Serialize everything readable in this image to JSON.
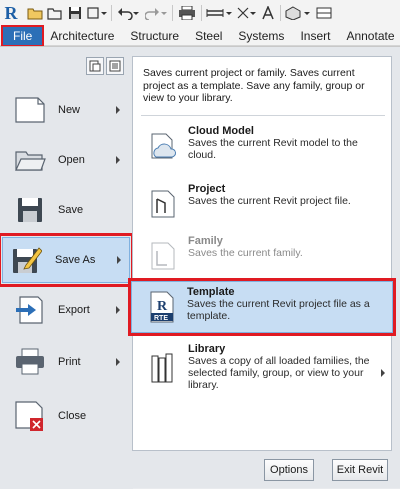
{
  "app": {
    "logo": "R"
  },
  "quick_access": {
    "icons": [
      "open-icon",
      "save-icon",
      "sync-icon",
      "undo-icon",
      "redo-icon",
      "print-icon",
      "measure-icon",
      "text-icon",
      "view-icon"
    ]
  },
  "ribbon": {
    "tabs": [
      {
        "label": "File"
      },
      {
        "label": "Architecture"
      },
      {
        "label": "Structure"
      },
      {
        "label": "Steel"
      },
      {
        "label": "Systems"
      },
      {
        "label": "Insert"
      },
      {
        "label": "Annotate"
      }
    ]
  },
  "menu": {
    "items": [
      {
        "label": "New",
        "has_submenu": true
      },
      {
        "label": "Open",
        "has_submenu": true
      },
      {
        "label": "Save",
        "has_submenu": false
      },
      {
        "label": "Save As",
        "has_submenu": true
      },
      {
        "label": "Export",
        "has_submenu": true
      },
      {
        "label": "Print",
        "has_submenu": true
      },
      {
        "label": "Close",
        "has_submenu": false
      }
    ],
    "description": "Saves current project or family. Saves current project as a template. Save any family, group or view to your library.",
    "options": [
      {
        "title": "Cloud Model",
        "text": "Saves the current Revit model to the cloud."
      },
      {
        "title": "Project",
        "text": "Saves the current Revit project file."
      },
      {
        "title": "Family",
        "text": "Saves the current family."
      },
      {
        "title": "Template",
        "text": "Saves the current Revit project file as a template."
      },
      {
        "title": "Library",
        "text": "Saves a copy of all loaded families, the selected family, group, or view to your library."
      }
    ],
    "template_badge": "RTE",
    "buttons": {
      "options": "Options",
      "exit": "Exit Revit"
    }
  },
  "colors": {
    "accent": "#2c6fb7",
    "highlight": "#c7ddf3",
    "annotation": "#e01a22"
  }
}
